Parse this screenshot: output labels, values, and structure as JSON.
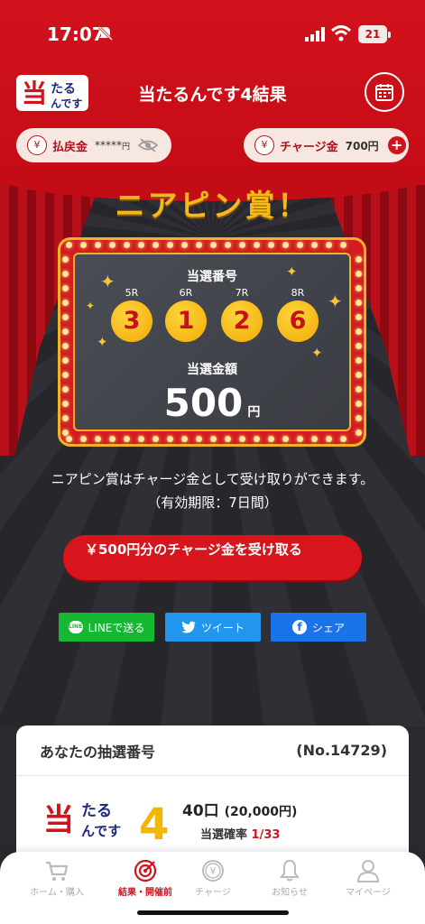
{
  "status_bar": {
    "time": "17:07",
    "battery": "21"
  },
  "header": {
    "title": "当たるんです4結果",
    "logo_text": "当たるんです",
    "payout": {
      "label": "払戻金",
      "value": "*****",
      "unit": "円"
    },
    "charge": {
      "label": "チャージ金",
      "value": "700円"
    }
  },
  "result": {
    "headline": "ニアピン賞！",
    "number_label": "当選番号",
    "races": [
      {
        "race": "5R",
        "number": "3"
      },
      {
        "race": "6R",
        "number": "1"
      },
      {
        "race": "7R",
        "number": "2"
      },
      {
        "race": "8R",
        "number": "6"
      }
    ],
    "amount_label": "当選金額",
    "amount": "500",
    "amount_unit": "円"
  },
  "message": {
    "line1": "ニアピン賞はチャージ金として受け取りができます。",
    "line2": "（有効期限：7日間）"
  },
  "cta_label": "￥500円分のチャージ金を受け取る",
  "share": {
    "line": "LINEで送る",
    "twitter": "ツイート",
    "facebook": "シェア"
  },
  "lottery_card": {
    "title": "あなたの抽選番号",
    "number": "(No.14729)",
    "count": "40口",
    "price": "(20,000円)",
    "prob_label": "当選確率",
    "prob_value": "1/33",
    "logo_digit": "4"
  },
  "tabs": [
    {
      "label": "ホーム・購入",
      "icon": "cart-icon",
      "active": false
    },
    {
      "label": "結果・開催前",
      "icon": "target-icon",
      "active": true
    },
    {
      "label": "チャージ",
      "icon": "yen-coin-icon",
      "active": false
    },
    {
      "label": "お知らせ",
      "icon": "bell-icon",
      "active": false
    },
    {
      "label": "マイページ",
      "icon": "user-icon",
      "active": false
    }
  ],
  "colors": {
    "brand_red": "#d2121c",
    "gold": "#f5b91a",
    "dark_bg": "#2a2a2e"
  }
}
